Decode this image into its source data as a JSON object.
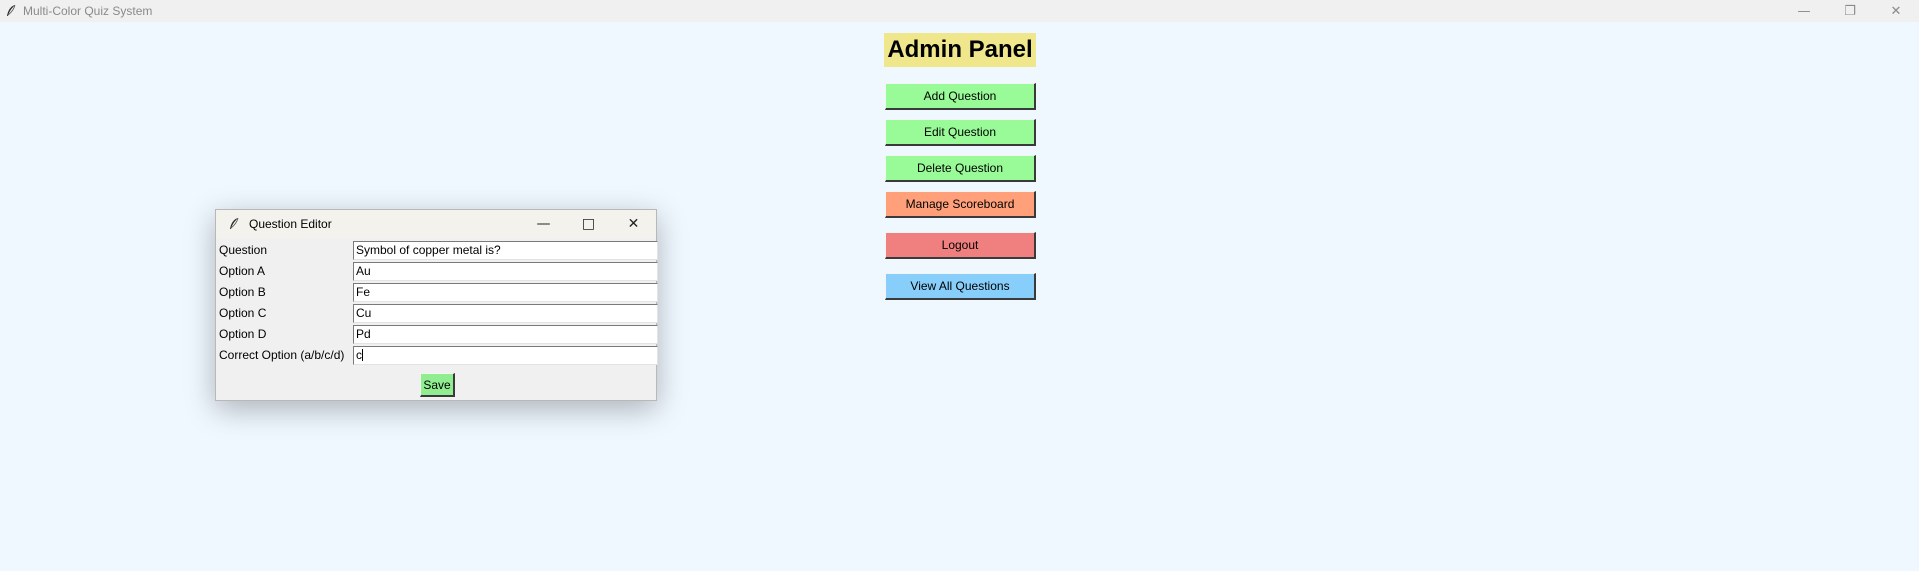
{
  "window": {
    "title": "Multi-Color Quiz System",
    "minimize_glyph": "—",
    "restore_glyph": "❐",
    "close_glyph": "✕"
  },
  "admin": {
    "title": "Admin Panel",
    "buttons": [
      {
        "label": "Add Question",
        "color": "#98fb98"
      },
      {
        "label": "Edit Question",
        "color": "#98fb98"
      },
      {
        "label": "Delete Question",
        "color": "#98fb98"
      },
      {
        "label": "Manage Scoreboard",
        "color": "#ffa07a"
      },
      {
        "label": "Logout",
        "color": "#f08080"
      },
      {
        "label": "View All Questions",
        "color": "#87cefa"
      }
    ]
  },
  "dialog": {
    "title": "Question Editor",
    "minimize_glyph": "—",
    "maximize_glyph": "□",
    "close_glyph": "✕",
    "fields": [
      {
        "label": "Question",
        "value": "Symbol of copper metal is?"
      },
      {
        "label": "Option A",
        "value": "Au"
      },
      {
        "label": "Option B",
        "value": "Fe"
      },
      {
        "label": "Option C",
        "value": "Cu"
      },
      {
        "label": "Option D",
        "value": "Pd"
      },
      {
        "label": "Correct Option (a/b/c/d)",
        "value": "c"
      }
    ],
    "save_label": "Save"
  },
  "colors": {
    "background": "#eff7ff",
    "admin_title_bg": "#f0e68c",
    "save_bg": "#90ee90"
  },
  "icons": {
    "app_icon": "feather-icon"
  }
}
